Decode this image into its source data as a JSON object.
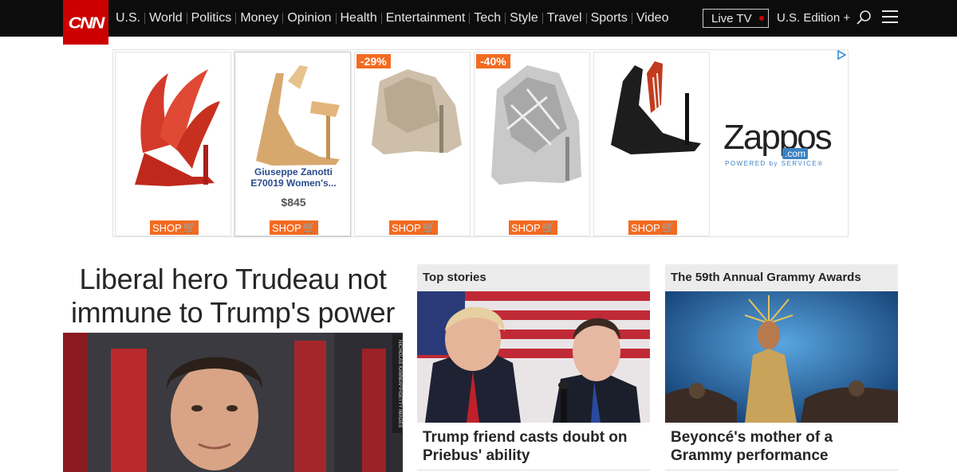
{
  "nav": {
    "logo": "CNN",
    "links": [
      "U.S.",
      "World",
      "Politics",
      "Money",
      "Opinion",
      "Health",
      "Entertainment",
      "Tech",
      "Style",
      "Travel",
      "Sports",
      "Video"
    ],
    "live_tv": "Live TV",
    "edition": "U.S. Edition +",
    "icons": [
      "search-icon",
      "menu-icon"
    ]
  },
  "ad": {
    "cards": [
      {
        "badge": "",
        "name": "",
        "price": "",
        "shop": "SHOP"
      },
      {
        "badge": "",
        "name": "Giuseppe Zanotti E70019 Women's...",
        "price": "$845",
        "shop": "SHOP"
      },
      {
        "badge": "-29%",
        "name": "",
        "price": "",
        "shop": "SHOP"
      },
      {
        "badge": "-40%",
        "name": "",
        "price": "",
        "shop": "SHOP"
      },
      {
        "badge": "",
        "name": "",
        "price": "",
        "shop": "SHOP"
      }
    ],
    "brand": {
      "word": "Zappos",
      "com": ".com",
      "tagline": "POWERED by SERVICE®"
    },
    "accent": "#f26b21",
    "icons": [
      "adchoices-icon",
      "cart-icon"
    ]
  },
  "lead": {
    "headline": "Liberal hero Trudeau not immune to Trump's power",
    "photo_credit": "NICHOLAS KAMM/AFP/GETTY IMAGES"
  },
  "top_stories": {
    "header": "Top stories",
    "title": "Trump friend casts doubt on Priebus' ability"
  },
  "grammys": {
    "header": "The 59th Annual Grammy Awards",
    "title": "Beyoncé's mother of a Grammy performance"
  },
  "colors": {
    "brand_red": "#cc0000",
    "nav_bg": "#0c0c0c",
    "text": "#262626"
  }
}
